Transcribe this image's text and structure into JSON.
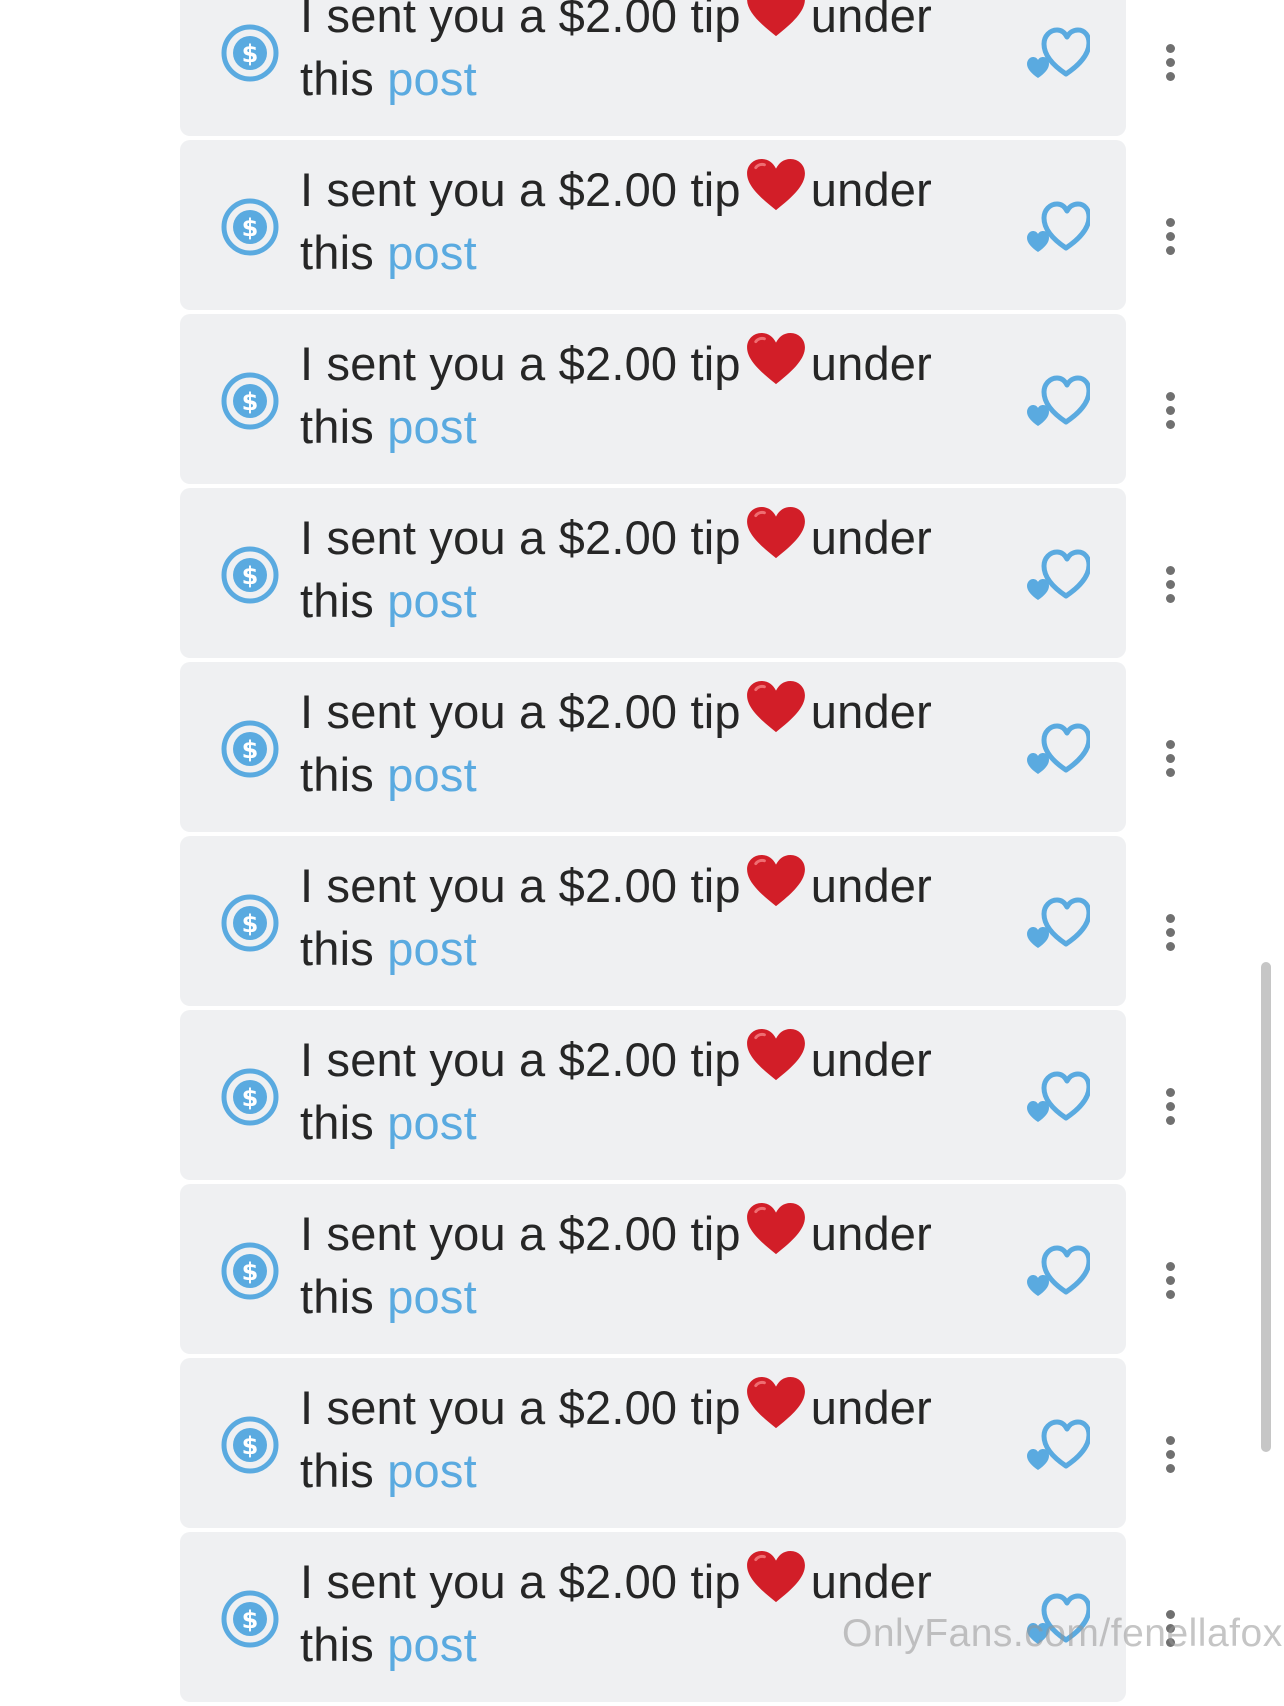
{
  "messages": [
    {
      "text_before": "I sent you a $2.00 tip",
      "text_after": "under this",
      "link_text": "post"
    },
    {
      "text_before": "I sent you a $2.00 tip",
      "text_after": "under this",
      "link_text": "post"
    },
    {
      "text_before": "I sent you a $2.00 tip",
      "text_after": "under this",
      "link_text": "post"
    },
    {
      "text_before": "I sent you a $2.00 tip",
      "text_after": "under this",
      "link_text": "post"
    },
    {
      "text_before": "I sent you a $2.00 tip",
      "text_after": "under this",
      "link_text": "post"
    },
    {
      "text_before": "I sent you a $2.00 tip",
      "text_after": "under this",
      "link_text": "post"
    },
    {
      "text_before": "I sent you a $2.00 tip",
      "text_after": "under this",
      "link_text": "post"
    },
    {
      "text_before": "I sent you a $2.00 tip",
      "text_after": "under this",
      "link_text": "post"
    },
    {
      "text_before": "I sent you a $2.00 tip",
      "text_after": "under this",
      "link_text": "post"
    },
    {
      "text_before": "I sent you a $2.00 tip",
      "text_after": "under this",
      "link_text": "post"
    }
  ],
  "icons": {
    "tip": "dollar-circle-icon",
    "heart_emoji": "red-heart-emoji",
    "like": "heart-like-icon",
    "more": "more-vertical-icon"
  },
  "colors": {
    "accent": "#5aaae0",
    "bubble": "#eff0f2",
    "text": "#262626",
    "heart": "#d21e28"
  },
  "watermark": "OnlyFans.com/fenellafox"
}
